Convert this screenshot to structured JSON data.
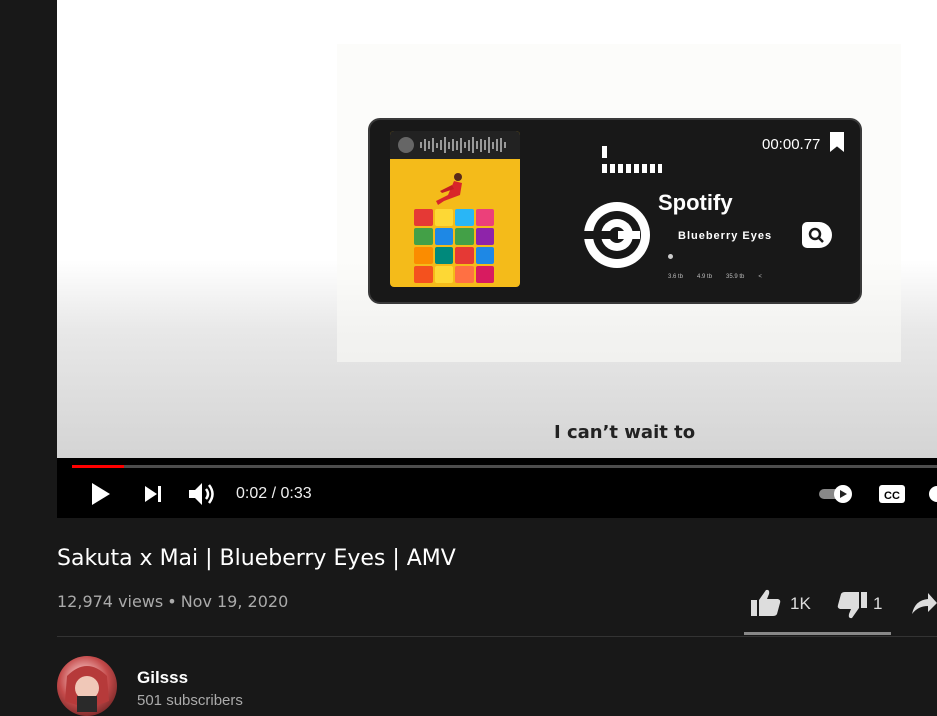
{
  "player": {
    "overlay": {
      "timestamp": "00:00.77",
      "brand": "Spotify",
      "song": "Blueberry Eyes",
      "stats": [
        "3.6 tb",
        "4.9 tb",
        "35.9 tb"
      ]
    },
    "subtitle": "I can’t wait to",
    "progress": 0.06,
    "time_display": "0:02 / 0:33",
    "icons": {
      "play": "play-icon",
      "next": "next-icon",
      "volume": "volume-icon",
      "autoplay": "autoplay-toggle-icon",
      "captions": "cc-icon",
      "settings": "settings-icon"
    },
    "colors": {
      "progress": "#ff0000",
      "cover": "#f4bb1a"
    }
  },
  "video": {
    "title": "Sakuta x Mai | Blueberry Eyes | AMV",
    "views": "12,974 views",
    "separator": "•",
    "date": "Nov 19, 2020",
    "likes": "1K",
    "dislikes": "1"
  },
  "channel": {
    "name": "Gilsss",
    "subscribers": "501 subscribers"
  }
}
